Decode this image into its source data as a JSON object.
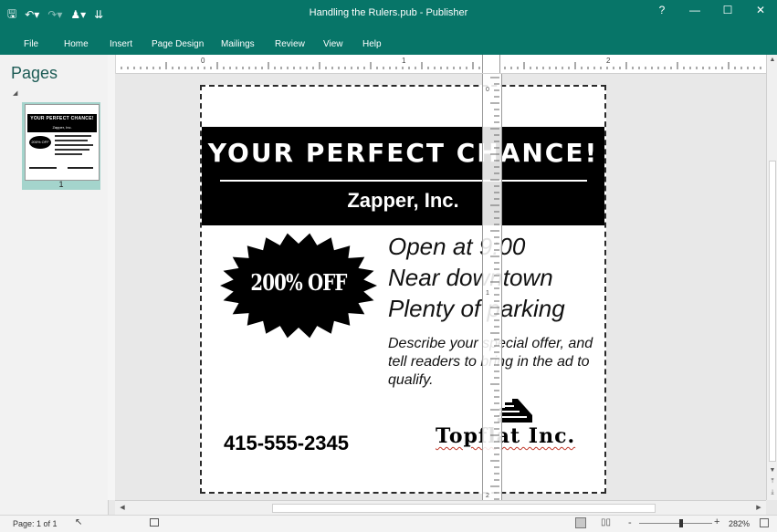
{
  "window": {
    "title": "Handling the Rulers.pub  -  Publisher",
    "help": "?",
    "minimize": "—",
    "maximize": "☐",
    "close": "✕"
  },
  "qat": {
    "save_icon": "save-icon",
    "undo_icon": "undo-icon",
    "redo_icon": "redo-icon",
    "user_icon": "user-icon",
    "customize": "customize-icon"
  },
  "menu": [
    "File",
    "Home",
    "Insert",
    "Page Design",
    "Mailings",
    "Review",
    "View",
    "Help"
  ],
  "pages_pane": {
    "title": "Pages",
    "collapse": "◢",
    "thumb_number": "1"
  },
  "rulers": {
    "h_labels": [
      "0",
      "1",
      "2"
    ],
    "v_labels": [
      "0",
      "1",
      "2"
    ]
  },
  "publication": {
    "headline": "YOUR PERFECT CHANCE!",
    "company": "Zapper, Inc.",
    "starburst": "200% OFF",
    "line1": "Open at 9:00",
    "line2": "Near downtown",
    "line3": "Plenty of parking",
    "description": "Describe your special offer, and tell readers to bring in the ad to qualify.",
    "phone": "415-555-2345",
    "logo_name": "Topflat Inc."
  },
  "thumbnail": {
    "headline": "YOUR PERFECT CHANCE!",
    "company": "Zapper, Inc.",
    "starburst": "200% OFF"
  },
  "status": {
    "page": "Page: 1 of 1",
    "zoom_minus": "-",
    "zoom_plus": "+",
    "zoom": "282%",
    "zoom_level": 0.55
  },
  "colors": {
    "accent": "#077568",
    "thumb_selected": "#a4d4cc"
  }
}
